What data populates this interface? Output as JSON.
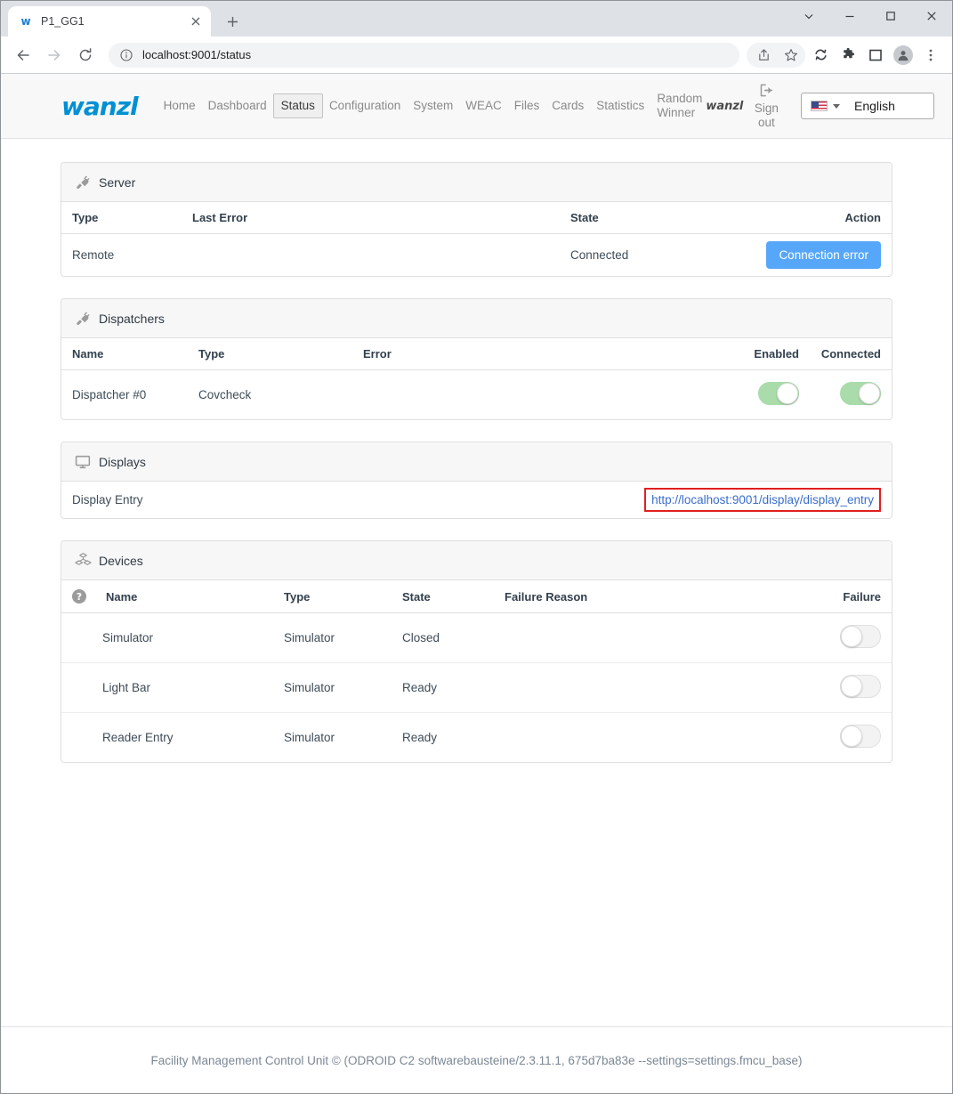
{
  "browser": {
    "tab": {
      "title": "P1_GG1",
      "favicon_letter": "w",
      "close_icon": "close-icon"
    },
    "new_tab_label": "+",
    "window_controls": {
      "minimize": "─",
      "maximize": "□",
      "close": "✕",
      "tablist": "⌄"
    },
    "toolbar": {
      "back": "←",
      "forward": "→",
      "reload": "⟳",
      "site_info_icon": "info-icon",
      "url": "localhost:9001/status",
      "share_icon": "share-icon",
      "bookmark_icon": "star-icon",
      "sync_icon": "sync-icon",
      "extensions_icon": "puzzle-icon",
      "sidepanel_icon": "side-panel-icon",
      "profile_icon": "profile-avatar-icon",
      "menu_icon": "three-dot-menu-icon"
    }
  },
  "header": {
    "logo": "wanzl",
    "nav": [
      {
        "label": "Home",
        "active": false
      },
      {
        "label": "Dashboard",
        "active": false
      },
      {
        "label": "Status",
        "active": true
      },
      {
        "label": "Configuration",
        "active": false
      },
      {
        "label": "System",
        "active": false
      },
      {
        "label": "WEAC",
        "active": false
      },
      {
        "label": "Files",
        "active": false
      },
      {
        "label": "Cards",
        "active": false
      },
      {
        "label": "Statistics",
        "active": false
      },
      {
        "label": "Random Winner",
        "active": false
      }
    ],
    "user": "wanzl",
    "sign_out": "Sign out",
    "language": {
      "value": "English",
      "flag": "us-flag-icon"
    }
  },
  "panels": {
    "server": {
      "title": "Server",
      "icon": "plug-icon",
      "columns": [
        "Type",
        "Last Error",
        "State",
        "Action"
      ],
      "rows": [
        {
          "type": "Remote",
          "last_error": "",
          "state": "Connected",
          "action": "Connection error"
        }
      ]
    },
    "dispatchers": {
      "title": "Dispatchers",
      "icon": "plug-icon",
      "columns": [
        "Name",
        "Type",
        "Error",
        "Enabled",
        "Connected"
      ],
      "rows": [
        {
          "name": "Dispatcher #0",
          "type": "Covcheck",
          "error": "",
          "enabled": true,
          "connected": true
        }
      ]
    },
    "displays": {
      "title": "Displays",
      "icon": "monitor-icon",
      "rows": [
        {
          "name": "Display Entry",
          "url": "http://localhost:9001/display/display_entry",
          "highlighted": true
        }
      ]
    },
    "devices": {
      "title": "Devices",
      "icon": "cubes-icon",
      "help_icon": "question-mark-icon",
      "columns": [
        "",
        "Name",
        "Type",
        "State",
        "Failure Reason",
        "Failure"
      ],
      "rows": [
        {
          "name": "Simulator",
          "type": "Simulator",
          "state": "Closed",
          "failure_reason": "",
          "failure": false
        },
        {
          "name": "Light Bar",
          "type": "Simulator",
          "state": "Ready",
          "failure_reason": "",
          "failure": false
        },
        {
          "name": "Reader Entry",
          "type": "Simulator",
          "state": "Ready",
          "failure_reason": "",
          "failure": false
        }
      ]
    }
  },
  "footer": {
    "text": "Facility Management Control Unit © (ODROID C2 softwarebausteine/2.3.11.1, 675d7ba83e --settings=settings.fmcu_base)"
  },
  "colors": {
    "brand": "#0090d4",
    "primary_button": "#56a7fa",
    "toggle_on": "#a9dcaa",
    "link": "#3a6ecb",
    "highlight_outline": "#e02020"
  }
}
